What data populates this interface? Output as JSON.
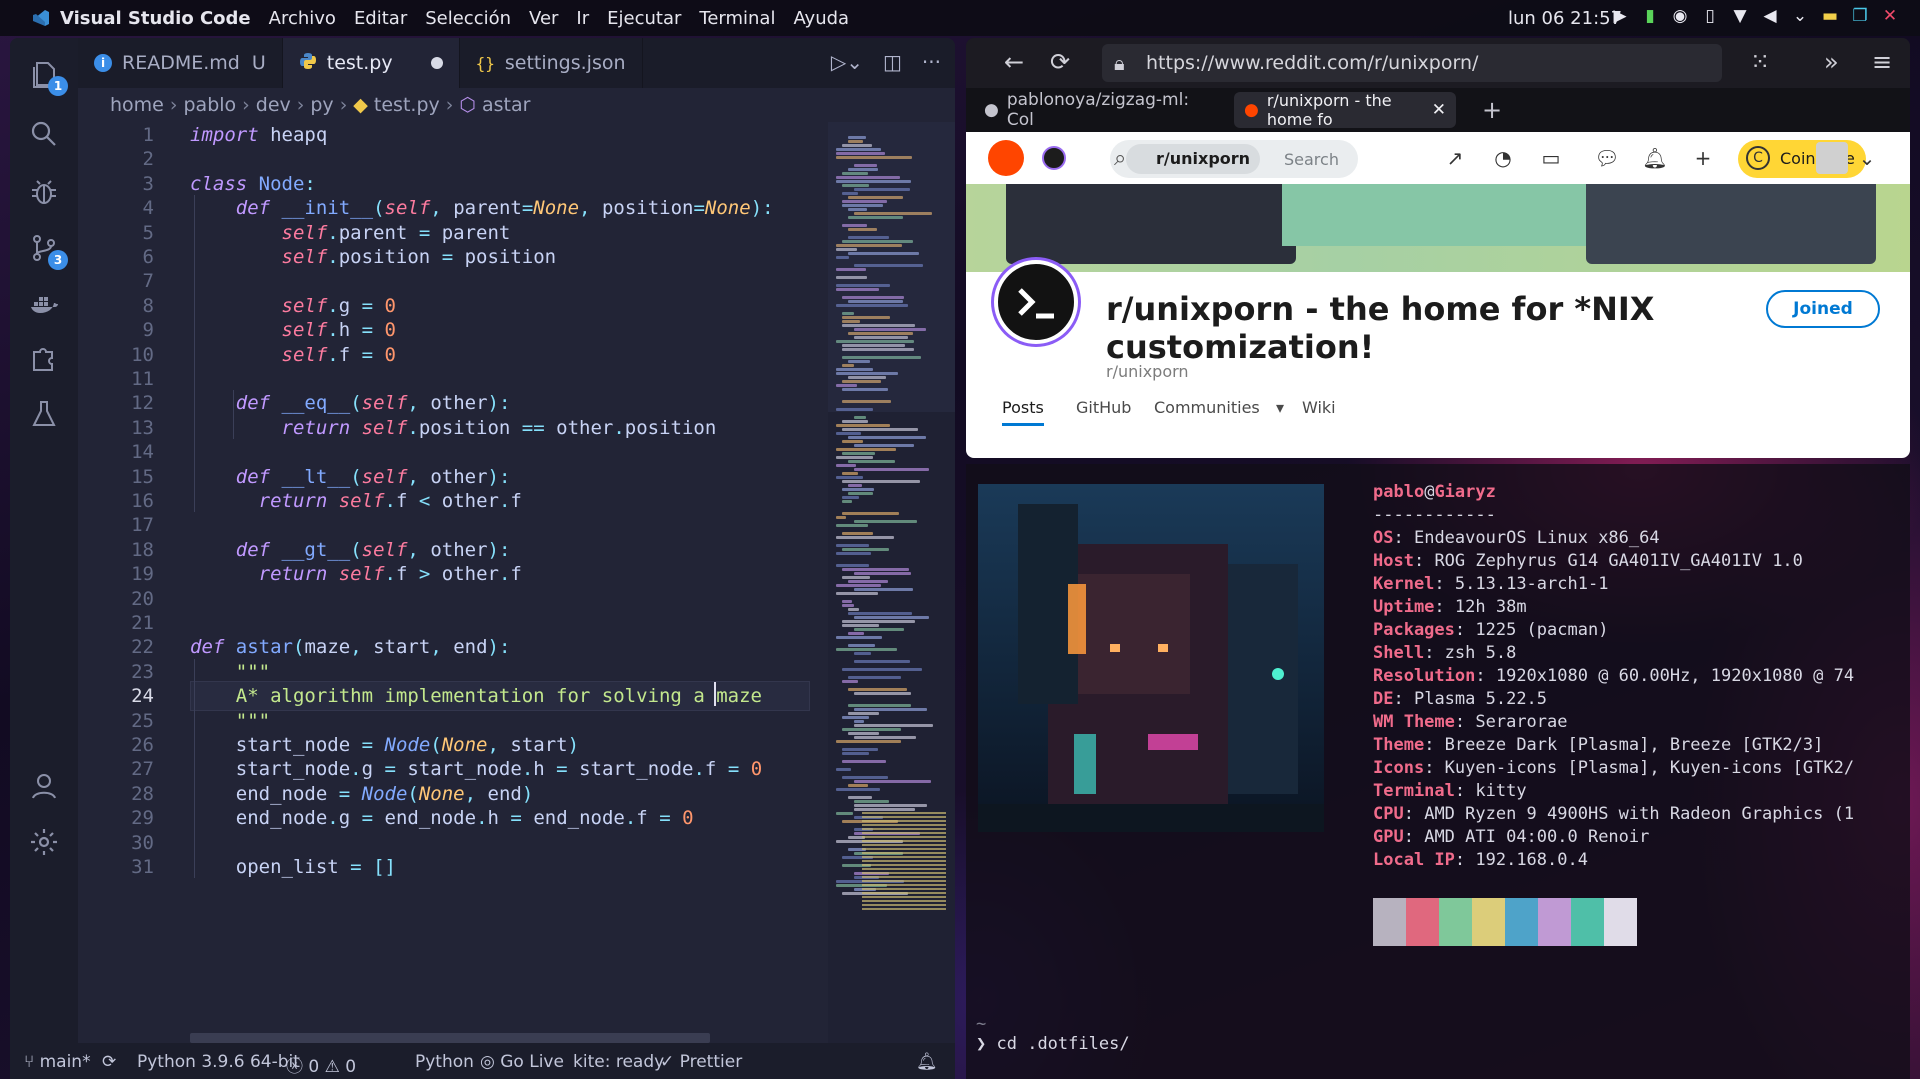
{
  "topbar": {
    "app_name": "Visual Studio Code",
    "menus": [
      "Archivo",
      "Editar",
      "Selección",
      "Ver",
      "Ir",
      "Ejecutar",
      "Terminal",
      "Ayuda"
    ],
    "clock": "lun 06 21:57",
    "tray_icons": [
      "media-play-icon",
      "battery-icon",
      "vpn-icon",
      "clipboard-icon",
      "wifi-icon",
      "volume-icon",
      "chevron-down-icon",
      "minimize-icon",
      "maximize-icon",
      "close-icon"
    ]
  },
  "vscode": {
    "activity_badges": {
      "explorer": "1",
      "scm": "3"
    },
    "tabs": [
      {
        "label": "README.md",
        "suffix": "U",
        "icon": "info-icon"
      },
      {
        "label": "test.py",
        "icon": "python-icon",
        "modified": true
      },
      {
        "label": "settings.json",
        "icon": "json-icon"
      }
    ],
    "breadcrumb": [
      "home",
      "pablo",
      "dev",
      "py",
      "test.py",
      "astar"
    ],
    "current_line": 24,
    "status": {
      "branch": "main*",
      "python": "Python 3.9.6 64-bit",
      "errors": "0",
      "warnings": "0",
      "language": "Python",
      "golive": "Go Live",
      "kite": "kite: ready",
      "prettier": "Prettier"
    }
  },
  "code_lines": [
    {
      "n": "1",
      "t": "import heapq"
    },
    {
      "n": "2",
      "t": ""
    },
    {
      "n": "3",
      "t": "class Node:"
    },
    {
      "n": "4",
      "t": "    def __init__(self, parent=None, position=None):"
    },
    {
      "n": "5",
      "t": "        self.parent = parent"
    },
    {
      "n": "6",
      "t": "        self.position = position"
    },
    {
      "n": "7",
      "t": ""
    },
    {
      "n": "8",
      "t": "        self.g = 0"
    },
    {
      "n": "9",
      "t": "        self.h = 0"
    },
    {
      "n": "10",
      "t": "        self.f = 0"
    },
    {
      "n": "11",
      "t": ""
    },
    {
      "n": "12",
      "t": "    def __eq__(self, other):"
    },
    {
      "n": "13",
      "t": "        return self.position == other.position"
    },
    {
      "n": "14",
      "t": ""
    },
    {
      "n": "15",
      "t": "    def __lt__(self, other):"
    },
    {
      "n": "16",
      "t": "      return self.f < other.f"
    },
    {
      "n": "17",
      "t": ""
    },
    {
      "n": "18",
      "t": "    def __gt__(self, other):"
    },
    {
      "n": "19",
      "t": "      return self.f > other.f"
    },
    {
      "n": "20",
      "t": ""
    },
    {
      "n": "21",
      "t": ""
    },
    {
      "n": "22",
      "t": "def astar(maze, start, end):"
    },
    {
      "n": "23",
      "t": "    \"\"\""
    },
    {
      "n": "24",
      "t": "    A* algorithm implementation for solving a maze"
    },
    {
      "n": "25",
      "t": "    \"\"\""
    },
    {
      "n": "26",
      "t": "    start_node = Node(None, start)"
    },
    {
      "n": "27",
      "t": "    start_node.g = start_node.h = start_node.f = 0"
    },
    {
      "n": "28",
      "t": "    end_node = Node(None, end)"
    },
    {
      "n": "29",
      "t": "    end_node.g = end_node.h = end_node.f = 0"
    },
    {
      "n": "30",
      "t": ""
    },
    {
      "n": "31",
      "t": "    open_list = []"
    }
  ],
  "browser": {
    "url": "https://www.reddit.com/r/unixporn/",
    "tabs": [
      {
        "label": "pablonoya/zigzag-ml: Col",
        "icon": "github-icon"
      },
      {
        "label": "r/unixporn - the home fo",
        "icon": "reddit-icon",
        "active": true
      }
    ],
    "reddit": {
      "search_chip": "r/unixporn",
      "search_placeholder": "Search",
      "coin_sale": "Coin Sale",
      "title": "r/unixporn - the home for *NIX customization!",
      "subname": "r/unixporn",
      "joined": "Joined",
      "nav": [
        "Posts",
        "GitHub",
        "Communities",
        "Wiki"
      ]
    }
  },
  "terminal": {
    "user": "pablo",
    "at": "@",
    "host": "Giaryz",
    "separator": "------------",
    "info": [
      {
        "k": "OS",
        "v": "EndeavourOS Linux x86_64"
      },
      {
        "k": "Host",
        "v": "ROG Zephyrus G14 GA401IV_GA401IV 1.0"
      },
      {
        "k": "Kernel",
        "v": "5.13.13-arch1-1"
      },
      {
        "k": "Uptime",
        "v": "12h 38m"
      },
      {
        "k": "Packages",
        "v": "1225 (pacman)"
      },
      {
        "k": "Shell",
        "v": "zsh 5.8"
      },
      {
        "k": "Resolution",
        "v": "1920x1080 @ 60.00Hz, 1920x1080 @ 74"
      },
      {
        "k": "DE",
        "v": "Plasma 5.22.5"
      },
      {
        "k": "WM Theme",
        "v": "Serarorae"
      },
      {
        "k": "Theme",
        "v": "Breeze Dark [Plasma], Breeze [GTK2/3]"
      },
      {
        "k": "Icons",
        "v": "Kuyen-icons [Plasma], Kuyen-icons [GTK2/"
      },
      {
        "k": "Terminal",
        "v": "kitty"
      },
      {
        "k": "CPU",
        "v": "AMD Ryzen 9 4900HS with Radeon Graphics (1"
      },
      {
        "k": "GPU",
        "v": "AMD ATI 04:00.0 Renoir"
      },
      {
        "k": "Local IP",
        "v": "192.168.0.4"
      }
    ],
    "swatch_colors": [
      "#b7b2bf",
      "#e0687e",
      "#7fc89a",
      "#dccd7a",
      "#4ea3c9",
      "#c09ad4",
      "#4fbfa8",
      "#e0dce8"
    ],
    "prompt_tilde": "~",
    "prompt_symbol": "❯",
    "command": "cd .dotfiles/"
  }
}
